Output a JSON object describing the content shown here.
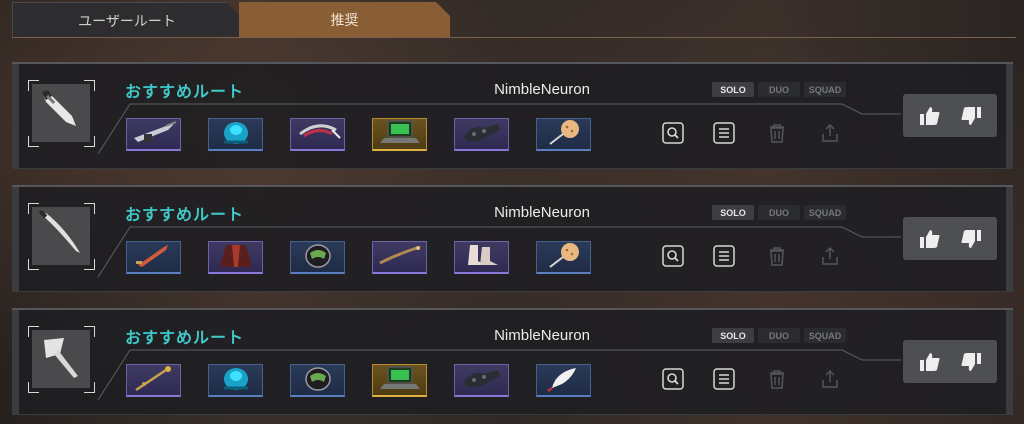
{
  "tabs": {
    "user_route": "ユーザールート",
    "recommended": "推奨",
    "active": "recommended"
  },
  "modes": [
    "SOLO",
    "DUO",
    "SQUAD"
  ],
  "routes": [
    {
      "name": "おすすめルート",
      "author": "NimbleNeuron",
      "weapon_icon": "dagger-icon",
      "items": [
        {
          "icon": "gun-blade-icon",
          "rarity": "purple"
        },
        {
          "icon": "blue-armor-icon",
          "rarity": "blue"
        },
        {
          "icon": "headband-icon",
          "rarity": "purple"
        },
        {
          "icon": "laptop-icon",
          "rarity": "gold"
        },
        {
          "icon": "gauntlet-icon",
          "rarity": "purple"
        },
        {
          "icon": "cookie-stick-icon",
          "rarity": "blue"
        }
      ]
    },
    {
      "name": "おすすめルート",
      "author": "NimbleNeuron",
      "weapon_icon": "curved-sword-icon",
      "items": [
        {
          "icon": "red-sword-icon",
          "rarity": "blue"
        },
        {
          "icon": "red-coat-icon",
          "rarity": "purple"
        },
        {
          "icon": "helmet-icon",
          "rarity": "blue"
        },
        {
          "icon": "staff-icon",
          "rarity": "purple"
        },
        {
          "icon": "boots-icon",
          "rarity": "purple"
        },
        {
          "icon": "cookie-stick-icon",
          "rarity": "blue"
        }
      ]
    },
    {
      "name": "おすすめルート",
      "author": "NimbleNeuron",
      "weapon_icon": "axe-icon",
      "items": [
        {
          "icon": "scepter-icon",
          "rarity": "purple"
        },
        {
          "icon": "blue-armor-icon",
          "rarity": "blue"
        },
        {
          "icon": "helmet-icon",
          "rarity": "blue"
        },
        {
          "icon": "laptop-icon",
          "rarity": "gold"
        },
        {
          "icon": "gauntlet-icon",
          "rarity": "purple"
        },
        {
          "icon": "feather-quill-icon",
          "rarity": "blue"
        }
      ]
    }
  ],
  "actions": [
    "search-icon",
    "list-icon",
    "trash-icon",
    "share-icon"
  ],
  "vote": [
    "thumbs-up-icon",
    "thumbs-down-icon"
  ],
  "colors": {
    "accent_tab": "#8a5e35",
    "route_name": "#3fc9c9",
    "rarity_purple": "#8a78d8",
    "rarity_blue": "#5a7ec0",
    "rarity_gold": "#e0b040"
  }
}
